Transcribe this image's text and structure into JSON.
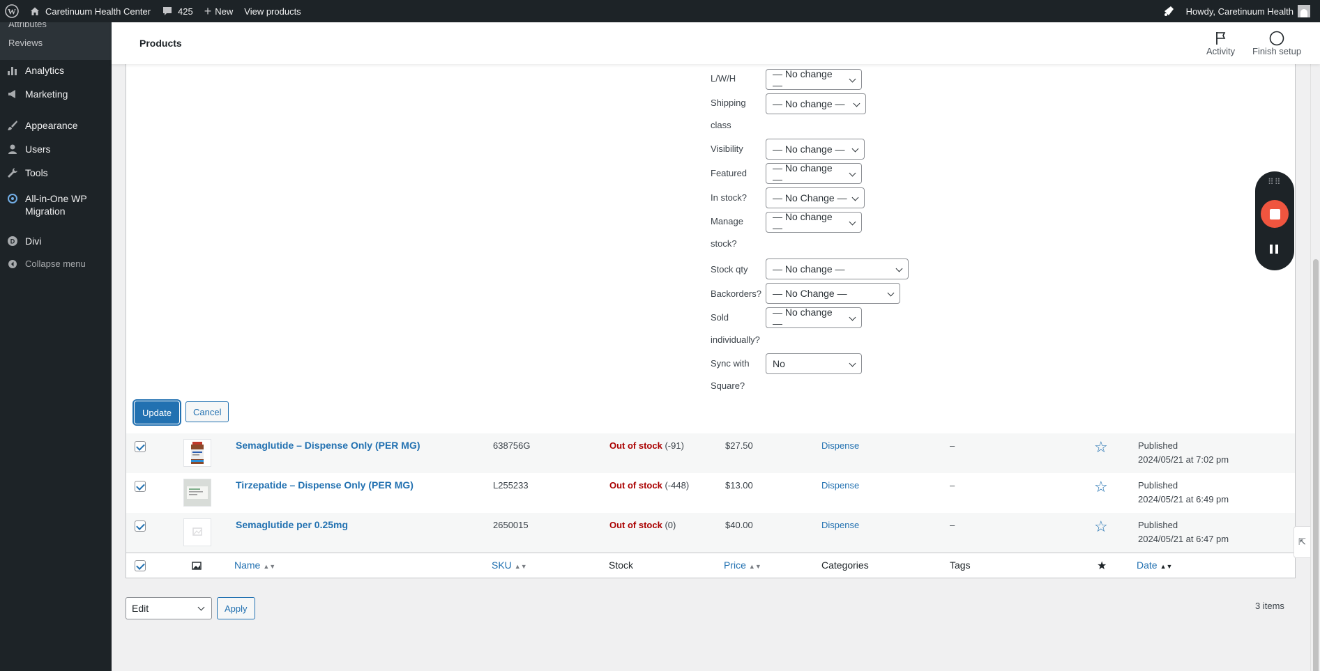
{
  "admin_bar": {
    "site_name": "Caretinuum Health Center",
    "comments_count": "425",
    "new_label": "New",
    "view_products": "View products",
    "howdy": "Howdy, Caretinuum Health"
  },
  "sidebar": {
    "sub_items": [
      "Attributes",
      "Reviews"
    ],
    "items": [
      {
        "label": "Analytics",
        "icon": "bar-chart-icon"
      },
      {
        "label": "Marketing",
        "icon": "megaphone-icon"
      },
      {
        "label": "Appearance",
        "icon": "paintbrush-icon"
      },
      {
        "label": "Users",
        "icon": "users-icon"
      },
      {
        "label": "Tools",
        "icon": "wrench-icon"
      },
      {
        "label": "All-in-One WP Migration",
        "icon": "migration-icon"
      },
      {
        "label": "Divi",
        "icon": "divi-icon"
      }
    ],
    "collapse": "Collapse menu"
  },
  "header": {
    "title": "Products",
    "activity": "Activity",
    "finish_setup": "Finish setup"
  },
  "bulk_edit": {
    "fields": [
      {
        "label": "L/W/H",
        "value": "— No change —"
      },
      {
        "label": "Shipping class",
        "value": "— No change —"
      },
      {
        "label": "Visibility",
        "value": "— No change —"
      },
      {
        "label": "Featured",
        "value": "— No change —"
      },
      {
        "label": "In stock?",
        "value": "— No Change —"
      },
      {
        "label": "Manage stock?",
        "value": "— No change —"
      },
      {
        "label": "Stock qty",
        "value": "— No change —"
      },
      {
        "label": "Backorders?",
        "value": "— No Change —"
      },
      {
        "label": "Sold individually?",
        "value": "— No change —"
      },
      {
        "label": "Sync with Square?",
        "value": "No"
      }
    ],
    "update": "Update",
    "cancel": "Cancel"
  },
  "products": [
    {
      "name": "Semaglutide – Dispense Only (PER MG)",
      "sku": "638756G",
      "stock_status": "Out of stock",
      "stock_qty": "(-91)",
      "price": "$27.50",
      "category": "Dispense",
      "tags": "–",
      "status": "Published",
      "date": "2024/05/21 at 7:02 pm"
    },
    {
      "name": "Tirzepatide – Dispense Only (PER MG)",
      "sku": "L255233",
      "stock_status": "Out of stock",
      "stock_qty": "(-448)",
      "price": "$13.00",
      "category": "Dispense",
      "tags": "–",
      "status": "Published",
      "date": "2024/05/21 at 6:49 pm"
    },
    {
      "name": "Semaglutide per 0.25mg",
      "sku": "2650015",
      "stock_status": "Out of stock",
      "stock_qty": "(0)",
      "price": "$40.00",
      "category": "Dispense",
      "tags": "–",
      "status": "Published",
      "date": "2024/05/21 at 6:47 pm"
    }
  ],
  "columns": {
    "name": "Name",
    "sku": "SKU",
    "stock": "Stock",
    "price": "Price",
    "categories": "Categories",
    "tags": "Tags",
    "date": "Date"
  },
  "bulk_actions": {
    "selected": "Edit",
    "apply": "Apply",
    "items_count": "3 items"
  },
  "colors": {
    "accent": "#2271b1",
    "out_of_stock": "#aa0000",
    "admin_dark": "#1d2327"
  }
}
